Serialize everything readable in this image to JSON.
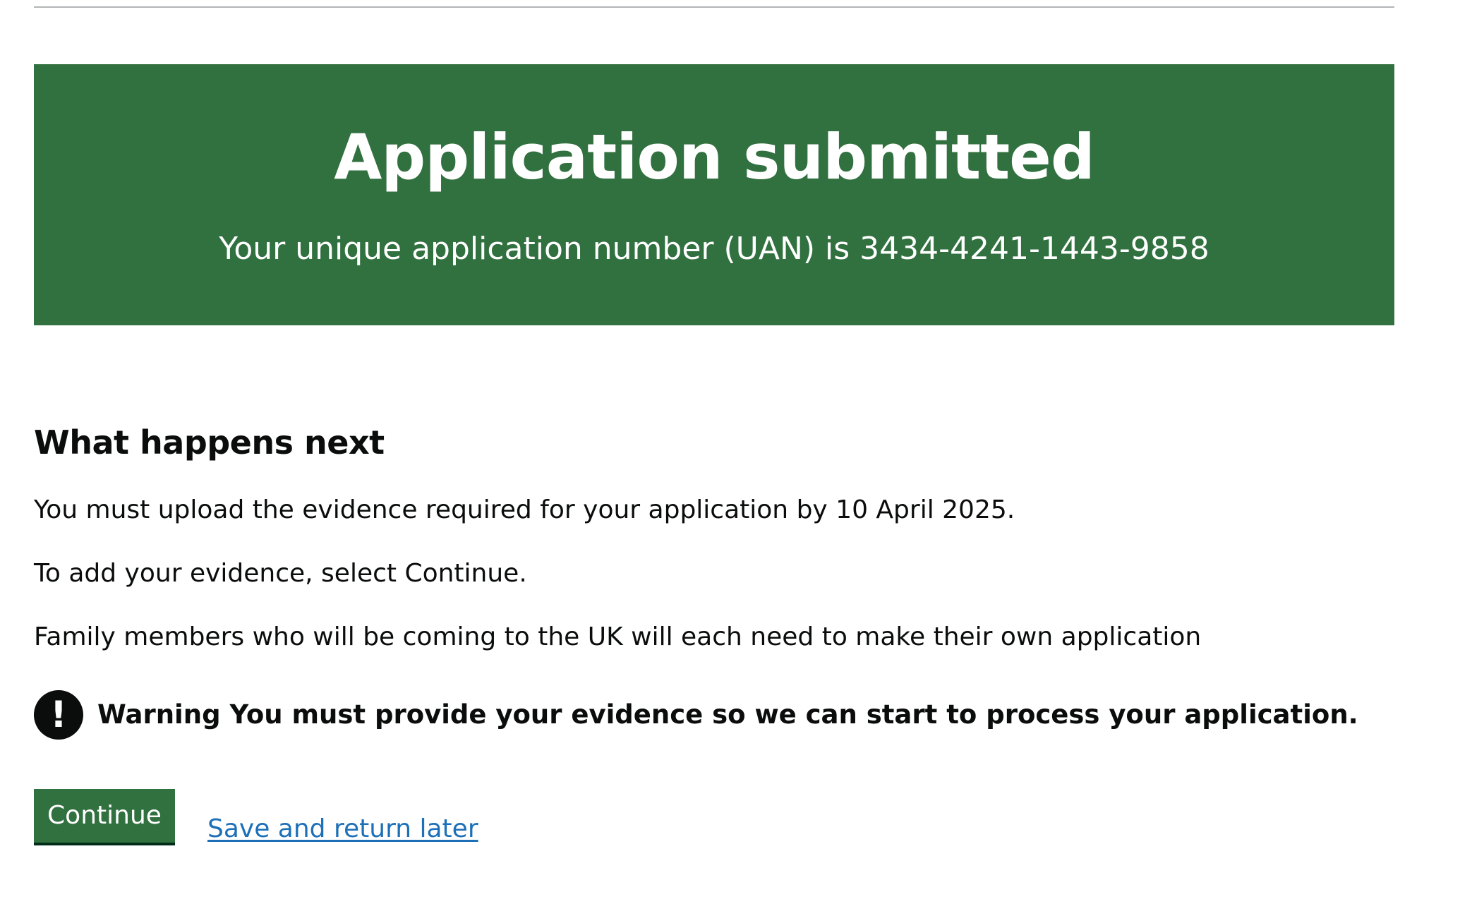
{
  "panel": {
    "title": "Application submitted",
    "body": "Your unique application number (UAN) is 3434-4241-1443-9858"
  },
  "next": {
    "heading": "What happens next",
    "paragraphs": [
      "You must upload the evidence required for your application by 10 April 2025.",
      "To add your evidence, select Continue.",
      "Family members who will be coming to the UK will each need to make their own application"
    ]
  },
  "warning": {
    "icon": "!",
    "label": "Warning",
    "text": "You must provide your evidence so we can start to process your application."
  },
  "actions": {
    "continue_label": "Continue",
    "save_link_label": "Save and return later"
  },
  "colors": {
    "panel_green": "#31703f",
    "link_blue": "#1d70b8",
    "text": "#0b0c0c"
  }
}
